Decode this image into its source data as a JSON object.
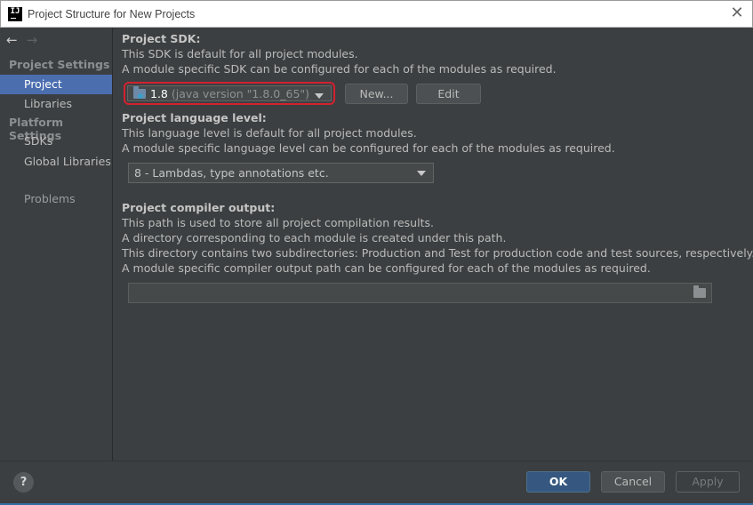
{
  "window": {
    "title": "Project Structure for New Projects",
    "app_icon_text": "IJ"
  },
  "sidebar": {
    "back_icon": "←",
    "forward_icon": "→",
    "sections": [
      {
        "title": "Project Settings",
        "items": [
          "Project",
          "Libraries"
        ]
      },
      {
        "title": "Platform Settings",
        "items": [
          "SDKs",
          "Global Libraries"
        ]
      }
    ],
    "selected": "Project",
    "problems_label": "Problems"
  },
  "sdk": {
    "heading": "Project SDK:",
    "desc1": "This SDK is default for all project modules.",
    "desc2": "A module specific SDK can be configured for each of the modules as required.",
    "selected_version": "1.8",
    "selected_detail": "(java version \"1.8.0_65\")",
    "new_button": "New...",
    "edit_button": "Edit"
  },
  "language": {
    "heading": "Project language level:",
    "desc1": "This language level is default for all project modules.",
    "desc2": "A module specific language level can be configured for each of the modules as required.",
    "selected": "8 - Lambdas, type annotations etc."
  },
  "compiler": {
    "heading": "Project compiler output:",
    "desc1": "This path is used to store all project compilation results.",
    "desc2": "A directory corresponding to each module is created under this path.",
    "desc3": "This directory contains two subdirectories: Production and Test for production code and test sources, respectively.",
    "desc4": "A module specific compiler output path can be configured for each of the modules as required.",
    "path_value": ""
  },
  "footer": {
    "help": "?",
    "ok": "OK",
    "cancel": "Cancel",
    "apply": "Apply"
  },
  "colors": {
    "background": "#3c3f41",
    "selection": "#4b6eaf",
    "ok_button": "#365880",
    "highlight_ring": "#d3212f"
  }
}
